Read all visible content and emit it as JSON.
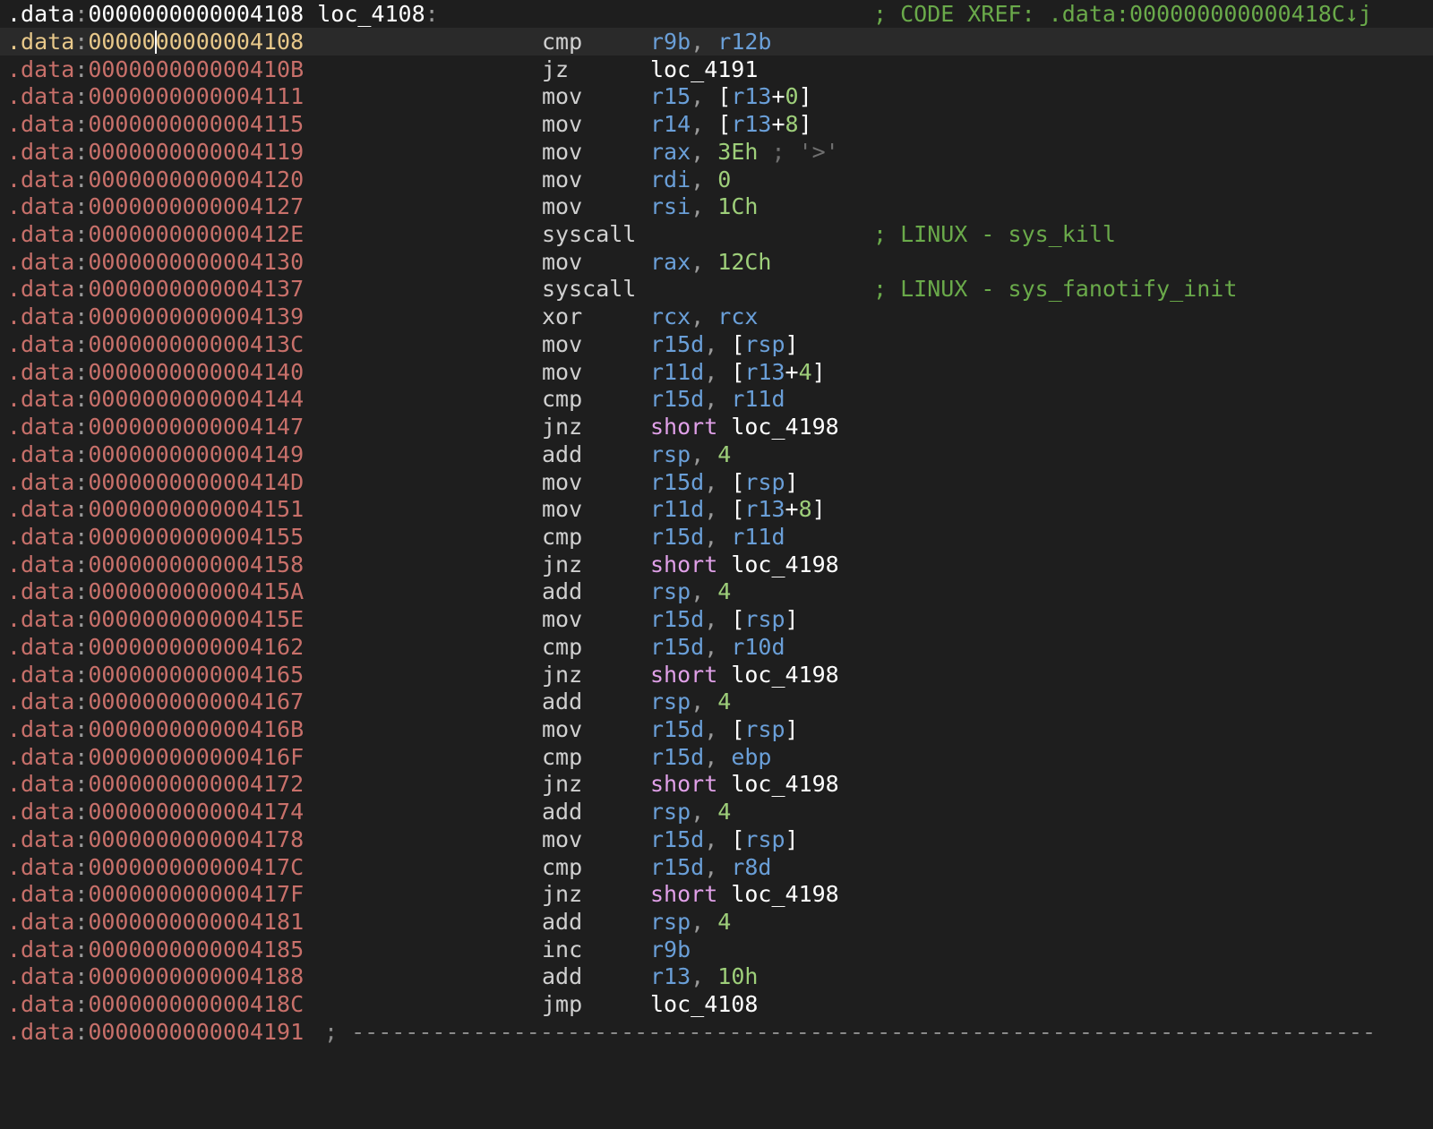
{
  "header": {
    "segment": ".data",
    "address": "0000000000004108",
    "label": "loc_4108",
    "xref_comment": "; CODE XREF: .data:000000000000418C↓j"
  },
  "rows": [
    {
      "seg": ".data",
      "addr": "0000000000004108",
      "mnem": "cmp",
      "ops": [
        {
          "t": "reg",
          "v": "r9b"
        },
        {
          "t": "punct",
          "v": ", "
        },
        {
          "t": "reg",
          "v": "r12b"
        }
      ]
    },
    {
      "seg": ".data",
      "addr": "000000000000410B",
      "mnem": "jz",
      "ops": [
        {
          "t": "name",
          "v": "loc_4191"
        }
      ]
    },
    {
      "seg": ".data",
      "addr": "0000000000004111",
      "mnem": "mov",
      "ops": [
        {
          "t": "reg",
          "v": "r15"
        },
        {
          "t": "punct",
          "v": ", "
        },
        {
          "t": "bracket",
          "v": "["
        },
        {
          "t": "reg",
          "v": "r13"
        },
        {
          "t": "bracket",
          "v": "+"
        },
        {
          "t": "num",
          "v": "0"
        },
        {
          "t": "bracket",
          "v": "]"
        }
      ]
    },
    {
      "seg": ".data",
      "addr": "0000000000004115",
      "mnem": "mov",
      "ops": [
        {
          "t": "reg",
          "v": "r14"
        },
        {
          "t": "punct",
          "v": ", "
        },
        {
          "t": "bracket",
          "v": "["
        },
        {
          "t": "reg",
          "v": "r13"
        },
        {
          "t": "bracket",
          "v": "+"
        },
        {
          "t": "num",
          "v": "8"
        },
        {
          "t": "bracket",
          "v": "]"
        }
      ]
    },
    {
      "seg": ".data",
      "addr": "0000000000004119",
      "mnem": "mov",
      "ops": [
        {
          "t": "reg",
          "v": "rax"
        },
        {
          "t": "punct",
          "v": ", "
        },
        {
          "t": "num",
          "v": "3Eh"
        },
        {
          "t": "cmtdim",
          "v": " ; '>'"
        }
      ]
    },
    {
      "seg": ".data",
      "addr": "0000000000004120",
      "mnem": "mov",
      "ops": [
        {
          "t": "reg",
          "v": "rdi"
        },
        {
          "t": "punct",
          "v": ", "
        },
        {
          "t": "num",
          "v": "0"
        }
      ]
    },
    {
      "seg": ".data",
      "addr": "0000000000004127",
      "mnem": "mov",
      "ops": [
        {
          "t": "reg",
          "v": "rsi"
        },
        {
          "t": "punct",
          "v": ", "
        },
        {
          "t": "num",
          "v": "1Ch"
        }
      ]
    },
    {
      "seg": ".data",
      "addr": "000000000000412E",
      "mnem": "syscall",
      "ops": [],
      "comment": "; LINUX - sys_kill"
    },
    {
      "seg": ".data",
      "addr": "0000000000004130",
      "mnem": "mov",
      "ops": [
        {
          "t": "reg",
          "v": "rax"
        },
        {
          "t": "punct",
          "v": ", "
        },
        {
          "t": "num",
          "v": "12Ch"
        }
      ]
    },
    {
      "seg": ".data",
      "addr": "0000000000004137",
      "mnem": "syscall",
      "ops": [],
      "comment": "; LINUX - sys_fanotify_init"
    },
    {
      "seg": ".data",
      "addr": "0000000000004139",
      "mnem": "xor",
      "ops": [
        {
          "t": "reg",
          "v": "rcx"
        },
        {
          "t": "punct",
          "v": ", "
        },
        {
          "t": "reg",
          "v": "rcx"
        }
      ]
    },
    {
      "seg": ".data",
      "addr": "000000000000413C",
      "mnem": "mov",
      "ops": [
        {
          "t": "reg",
          "v": "r15d"
        },
        {
          "t": "punct",
          "v": ", "
        },
        {
          "t": "bracket",
          "v": "["
        },
        {
          "t": "reg",
          "v": "rsp"
        },
        {
          "t": "bracket",
          "v": "]"
        }
      ]
    },
    {
      "seg": ".data",
      "addr": "0000000000004140",
      "mnem": "mov",
      "ops": [
        {
          "t": "reg",
          "v": "r11d"
        },
        {
          "t": "punct",
          "v": ", "
        },
        {
          "t": "bracket",
          "v": "["
        },
        {
          "t": "reg",
          "v": "r13"
        },
        {
          "t": "bracket",
          "v": "+"
        },
        {
          "t": "num",
          "v": "4"
        },
        {
          "t": "bracket",
          "v": "]"
        }
      ]
    },
    {
      "seg": ".data",
      "addr": "0000000000004144",
      "mnem": "cmp",
      "ops": [
        {
          "t": "reg",
          "v": "r15d"
        },
        {
          "t": "punct",
          "v": ", "
        },
        {
          "t": "reg",
          "v": "r11d"
        }
      ]
    },
    {
      "seg": ".data",
      "addr": "0000000000004147",
      "mnem": "jnz",
      "ops": [
        {
          "t": "kw",
          "v": "short"
        },
        {
          "t": "punct",
          "v": " "
        },
        {
          "t": "name",
          "v": "loc_4198"
        }
      ]
    },
    {
      "seg": ".data",
      "addr": "0000000000004149",
      "mnem": "add",
      "ops": [
        {
          "t": "reg",
          "v": "rsp"
        },
        {
          "t": "punct",
          "v": ", "
        },
        {
          "t": "num",
          "v": "4"
        }
      ]
    },
    {
      "seg": ".data",
      "addr": "000000000000414D",
      "mnem": "mov",
      "ops": [
        {
          "t": "reg",
          "v": "r15d"
        },
        {
          "t": "punct",
          "v": ", "
        },
        {
          "t": "bracket",
          "v": "["
        },
        {
          "t": "reg",
          "v": "rsp"
        },
        {
          "t": "bracket",
          "v": "]"
        }
      ]
    },
    {
      "seg": ".data",
      "addr": "0000000000004151",
      "mnem": "mov",
      "ops": [
        {
          "t": "reg",
          "v": "r11d"
        },
        {
          "t": "punct",
          "v": ", "
        },
        {
          "t": "bracket",
          "v": "["
        },
        {
          "t": "reg",
          "v": "r13"
        },
        {
          "t": "bracket",
          "v": "+"
        },
        {
          "t": "num",
          "v": "8"
        },
        {
          "t": "bracket",
          "v": "]"
        }
      ]
    },
    {
      "seg": ".data",
      "addr": "0000000000004155",
      "mnem": "cmp",
      "ops": [
        {
          "t": "reg",
          "v": "r15d"
        },
        {
          "t": "punct",
          "v": ", "
        },
        {
          "t": "reg",
          "v": "r11d"
        }
      ]
    },
    {
      "seg": ".data",
      "addr": "0000000000004158",
      "mnem": "jnz",
      "ops": [
        {
          "t": "kw",
          "v": "short"
        },
        {
          "t": "punct",
          "v": " "
        },
        {
          "t": "name",
          "v": "loc_4198"
        }
      ]
    },
    {
      "seg": ".data",
      "addr": "000000000000415A",
      "mnem": "add",
      "ops": [
        {
          "t": "reg",
          "v": "rsp"
        },
        {
          "t": "punct",
          "v": ", "
        },
        {
          "t": "num",
          "v": "4"
        }
      ]
    },
    {
      "seg": ".data",
      "addr": "000000000000415E",
      "mnem": "mov",
      "ops": [
        {
          "t": "reg",
          "v": "r15d"
        },
        {
          "t": "punct",
          "v": ", "
        },
        {
          "t": "bracket",
          "v": "["
        },
        {
          "t": "reg",
          "v": "rsp"
        },
        {
          "t": "bracket",
          "v": "]"
        }
      ]
    },
    {
      "seg": ".data",
      "addr": "0000000000004162",
      "mnem": "cmp",
      "ops": [
        {
          "t": "reg",
          "v": "r15d"
        },
        {
          "t": "punct",
          "v": ", "
        },
        {
          "t": "reg",
          "v": "r10d"
        }
      ]
    },
    {
      "seg": ".data",
      "addr": "0000000000004165",
      "mnem": "jnz",
      "ops": [
        {
          "t": "kw",
          "v": "short"
        },
        {
          "t": "punct",
          "v": " "
        },
        {
          "t": "name",
          "v": "loc_4198"
        }
      ]
    },
    {
      "seg": ".data",
      "addr": "0000000000004167",
      "mnem": "add",
      "ops": [
        {
          "t": "reg",
          "v": "rsp"
        },
        {
          "t": "punct",
          "v": ", "
        },
        {
          "t": "num",
          "v": "4"
        }
      ]
    },
    {
      "seg": ".data",
      "addr": "000000000000416B",
      "mnem": "mov",
      "ops": [
        {
          "t": "reg",
          "v": "r15d"
        },
        {
          "t": "punct",
          "v": ", "
        },
        {
          "t": "bracket",
          "v": "["
        },
        {
          "t": "reg",
          "v": "rsp"
        },
        {
          "t": "bracket",
          "v": "]"
        }
      ]
    },
    {
      "seg": ".data",
      "addr": "000000000000416F",
      "mnem": "cmp",
      "ops": [
        {
          "t": "reg",
          "v": "r15d"
        },
        {
          "t": "punct",
          "v": ", "
        },
        {
          "t": "reg",
          "v": "ebp"
        }
      ]
    },
    {
      "seg": ".data",
      "addr": "0000000000004172",
      "mnem": "jnz",
      "ops": [
        {
          "t": "kw",
          "v": "short"
        },
        {
          "t": "punct",
          "v": " "
        },
        {
          "t": "name",
          "v": "loc_4198"
        }
      ]
    },
    {
      "seg": ".data",
      "addr": "0000000000004174",
      "mnem": "add",
      "ops": [
        {
          "t": "reg",
          "v": "rsp"
        },
        {
          "t": "punct",
          "v": ", "
        },
        {
          "t": "num",
          "v": "4"
        }
      ]
    },
    {
      "seg": ".data",
      "addr": "0000000000004178",
      "mnem": "mov",
      "ops": [
        {
          "t": "reg",
          "v": "r15d"
        },
        {
          "t": "punct",
          "v": ", "
        },
        {
          "t": "bracket",
          "v": "["
        },
        {
          "t": "reg",
          "v": "rsp"
        },
        {
          "t": "bracket",
          "v": "]"
        }
      ]
    },
    {
      "seg": ".data",
      "addr": "000000000000417C",
      "mnem": "cmp",
      "ops": [
        {
          "t": "reg",
          "v": "r15d"
        },
        {
          "t": "punct",
          "v": ", "
        },
        {
          "t": "reg",
          "v": "r8d"
        }
      ]
    },
    {
      "seg": ".data",
      "addr": "000000000000417F",
      "mnem": "jnz",
      "ops": [
        {
          "t": "kw",
          "v": "short"
        },
        {
          "t": "punct",
          "v": " "
        },
        {
          "t": "name",
          "v": "loc_4198"
        }
      ]
    },
    {
      "seg": ".data",
      "addr": "0000000000004181",
      "mnem": "add",
      "ops": [
        {
          "t": "reg",
          "v": "rsp"
        },
        {
          "t": "punct",
          "v": ", "
        },
        {
          "t": "num",
          "v": "4"
        }
      ]
    },
    {
      "seg": ".data",
      "addr": "0000000000004185",
      "mnem": "inc",
      "ops": [
        {
          "t": "reg",
          "v": "r9b"
        }
      ]
    },
    {
      "seg": ".data",
      "addr": "0000000000004188",
      "mnem": "add",
      "ops": [
        {
          "t": "reg",
          "v": "r13"
        },
        {
          "t": "punct",
          "v": ", "
        },
        {
          "t": "num",
          "v": "10h"
        }
      ]
    },
    {
      "seg": ".data",
      "addr": "000000000000418C",
      "mnem": "jmp",
      "ops": [
        {
          "t": "name",
          "v": "loc_4108"
        }
      ]
    }
  ],
  "footer": {
    "seg": ".data",
    "addr": "0000000000004191",
    "separator": "; ----------------------------------------------------------------------------"
  },
  "colors": {
    "background": "#1e1e1e",
    "address": "#c8706a",
    "current_address": "#e8c88a",
    "register": "#6a9fd8",
    "number": "#9ecf7a",
    "keyword": "#e0a0e8",
    "comment": "#6aaa4a"
  }
}
